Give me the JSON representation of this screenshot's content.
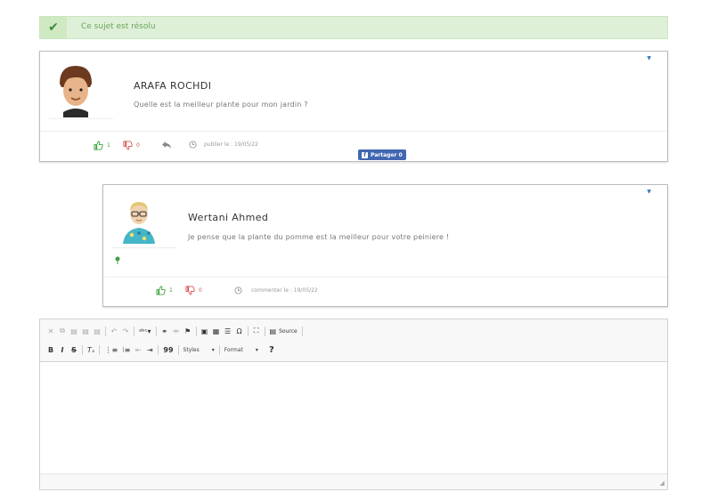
{
  "resolved": {
    "text": "Ce sujet est résolu"
  },
  "question": {
    "author": "ARAFA ROCHDI",
    "message": "Quelle est la meilleur plante pour mon jardin ?",
    "likes": "1",
    "dislikes": "0",
    "date": "publier le : 19/05/22",
    "share_label": "Partager 0"
  },
  "comment": {
    "author": "Wertani Ahmed",
    "message": "Je pense que la plante du pomme est la meilleur pour votre peiniere !",
    "likes": "1",
    "dislikes": "0",
    "date": "commenter le : 19/05/22"
  },
  "editor": {
    "source_label": "Source",
    "styles_label": "Styles",
    "format_label": "Format",
    "help_label": "?",
    "bold_label": "B",
    "italic_label": "I",
    "strike_label": "S",
    "blockquote_label": "99"
  }
}
